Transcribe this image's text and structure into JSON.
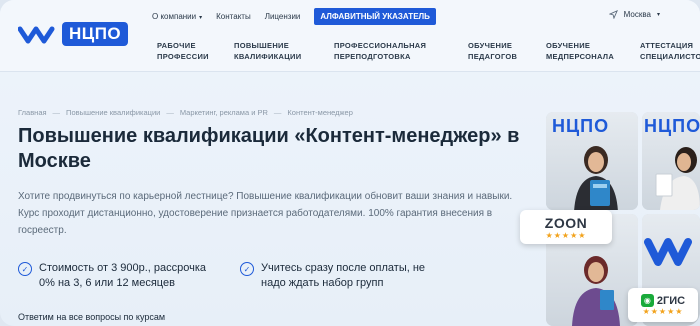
{
  "brand": {
    "logo_text": "НЦПО",
    "accent": "#1f5ad8"
  },
  "topnav": {
    "about": "О компании",
    "contacts": "Контакты",
    "licenses": "Лицензии",
    "alphabet": "АЛФАВИТНЫЙ УКАЗАТЕЛЬ"
  },
  "city": "Москва",
  "mainnav": [
    {
      "line1": "РАБОЧИЕ",
      "line2": "ПРОФЕССИИ"
    },
    {
      "line1": "ПОВЫШЕНИЕ",
      "line2": "КВАЛИФИКАЦИИ"
    },
    {
      "line1": "ПРОФЕССИОНАЛЬНАЯ",
      "line2": "ПЕРЕПОДГОТОВКА"
    },
    {
      "line1": "ОБУЧЕНИЕ",
      "line2": "ПЕДАГОГОВ"
    },
    {
      "line1": "ОБУЧЕНИЕ",
      "line2": "МЕДПЕРСОНАЛА"
    },
    {
      "line1": "АТТЕСТАЦИЯ",
      "line2": "СПЕЦИАЛИСТОВ"
    }
  ],
  "breadcrumb": [
    "Главная",
    "Повышение квалификации",
    "Маркетинг, реклама и PR",
    "Контент-менеджер"
  ],
  "title": "Повышение квалификации «Контент-менеджер» в Москве",
  "description": "Хотите продвинуться по карьерной лестнице? Повышение квалификации обновит ваши знания и навыки. Курс проходит дистанционно, удостоверение признается работодателями. 100% гарантия внесения в госреестр.",
  "benefits": [
    {
      "line1": "Стоимость от 3 900р., рассрочка",
      "line2": "0% на 3, 6 или 12 месяцев"
    },
    {
      "line1": "Учитесь сразу после оплаты, не",
      "line2": "надо ждать набор групп"
    }
  ],
  "bottom_text": "Ответим на все вопросы по курсам",
  "badges": {
    "zoon": {
      "name": "ZOON",
      "stars": "★★★★★"
    },
    "gis": {
      "name": "2ГИС",
      "stars": "★★★★★"
    }
  },
  "photo_sign": "НЦПО"
}
